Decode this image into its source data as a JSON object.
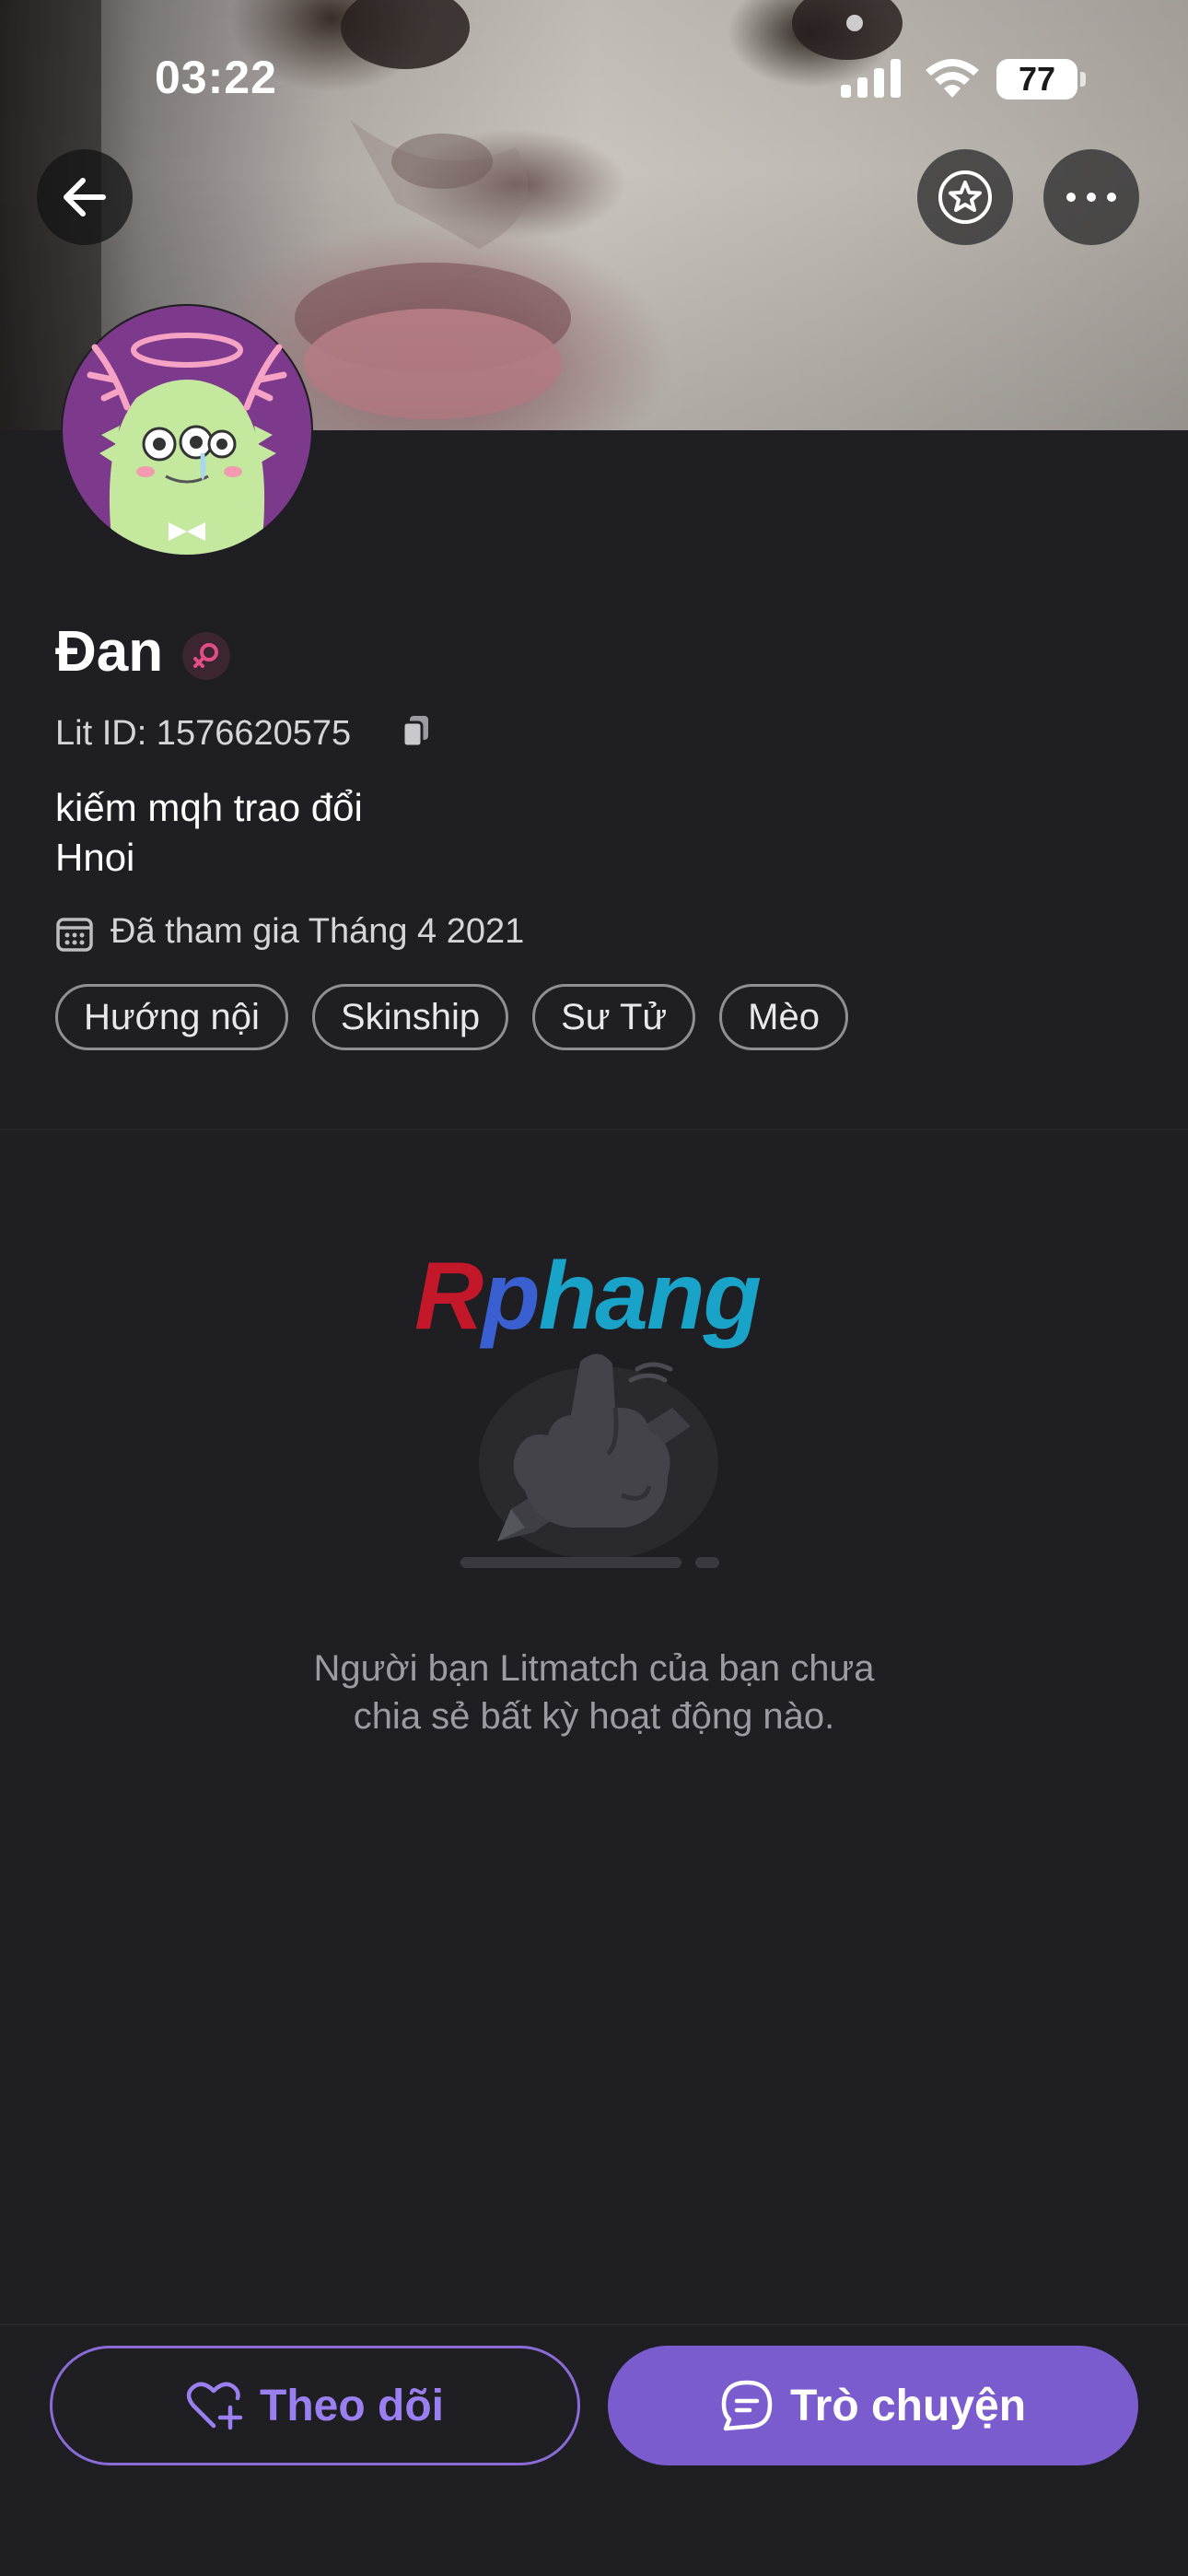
{
  "status_bar": {
    "time": "03:22",
    "battery": "77"
  },
  "profile": {
    "name": "Đan",
    "lit_id": "Lit ID: 1576620575",
    "bio": "kiếm mqh trao đổi\nHnoi",
    "joined": "Đã tham gia Tháng 4 2021",
    "tags": [
      "Hướng nội",
      "Skinship",
      "Sư Tử",
      "Mèo"
    ]
  },
  "watermark": {
    "part1": "R",
    "part2": "p",
    "part3": "hang"
  },
  "empty_state": {
    "message": "Người bạn Litmatch của bạn chưa\nchia sẻ bất kỳ hoạt động nào."
  },
  "actions": {
    "follow_label": "Theo dõi",
    "chat_label": "Trò chuyện"
  },
  "colors": {
    "background": "#1f1e22",
    "accent": "#7b5ccf",
    "gender_badge": "#e24d86"
  },
  "icons": {
    "back": "arrow-left-icon",
    "star": "star-icon",
    "more": "more-dots-icon",
    "copy": "copy-icon",
    "calendar": "calendar-icon",
    "heart_plus": "heart-plus-icon",
    "chat": "chat-bubble-icon",
    "gender": "female-icon"
  }
}
